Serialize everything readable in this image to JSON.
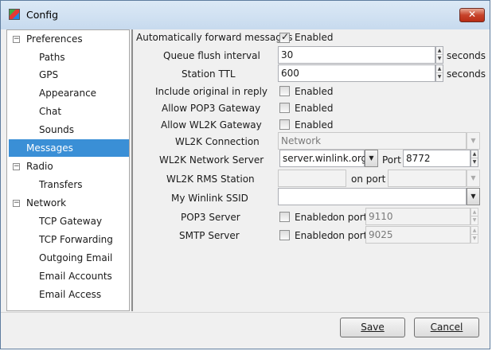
{
  "window": {
    "title": "Config",
    "close_label": "✕"
  },
  "tree": {
    "items": [
      {
        "label": "Preferences",
        "expander": "−"
      },
      {
        "label": "Paths"
      },
      {
        "label": "GPS"
      },
      {
        "label": "Appearance"
      },
      {
        "label": "Chat"
      },
      {
        "label": "Sounds"
      },
      {
        "label": "Messages"
      },
      {
        "label": "Radio",
        "expander": "−"
      },
      {
        "label": "Transfers"
      },
      {
        "label": "Network",
        "expander": "−"
      },
      {
        "label": "TCP Gateway"
      },
      {
        "label": "TCP Forwarding"
      },
      {
        "label": "Outgoing Email"
      },
      {
        "label": "Email Accounts"
      },
      {
        "label": "Email Access"
      }
    ],
    "selected": "Messages"
  },
  "form": {
    "auto_forward": {
      "label": "Automatically forward messages",
      "checkbox_label": "Enabled",
      "checked": true
    },
    "queue_flush": {
      "label": "Queue flush interval",
      "value": "30",
      "unit": "seconds"
    },
    "station_ttl": {
      "label": "Station TTL",
      "value": "600",
      "unit": "seconds"
    },
    "include_original": {
      "label": "Include original in reply",
      "checkbox_label": "Enabled",
      "checked": false
    },
    "allow_pop3": {
      "label": "Allow POP3 Gateway",
      "checkbox_label": "Enabled",
      "checked": false
    },
    "allow_wl2k": {
      "label": "Allow WL2K Gateway",
      "checkbox_label": "Enabled",
      "checked": false
    },
    "wl2k_connection": {
      "label": "WL2K Connection",
      "value": "Network"
    },
    "wl2k_server": {
      "label": "WL2K Network Server",
      "value": "server.winlink.org",
      "port_label": "Port",
      "port_value": "8772"
    },
    "wl2k_rms": {
      "label": "WL2K RMS Station",
      "value": "",
      "on_port_label": "on port",
      "port_value": ""
    },
    "winlink_ssid": {
      "label": "My Winlink SSID",
      "value": ""
    },
    "pop3_server": {
      "label": "POP3 Server",
      "checkbox_label": "Enabled",
      "checked": false,
      "on_port_label": "on port",
      "port_value": "9110"
    },
    "smtp_server": {
      "label": "SMTP Server",
      "checkbox_label": "Enabled",
      "checked": false,
      "on_port_label": "on port",
      "port_value": "9025"
    }
  },
  "buttons": {
    "save_label": "Save",
    "cancel_label": "Cancel"
  },
  "icons": {
    "checkmark": "✓",
    "spin_up": "▲",
    "spin_down": "▼",
    "combo_arrow": "▼"
  }
}
